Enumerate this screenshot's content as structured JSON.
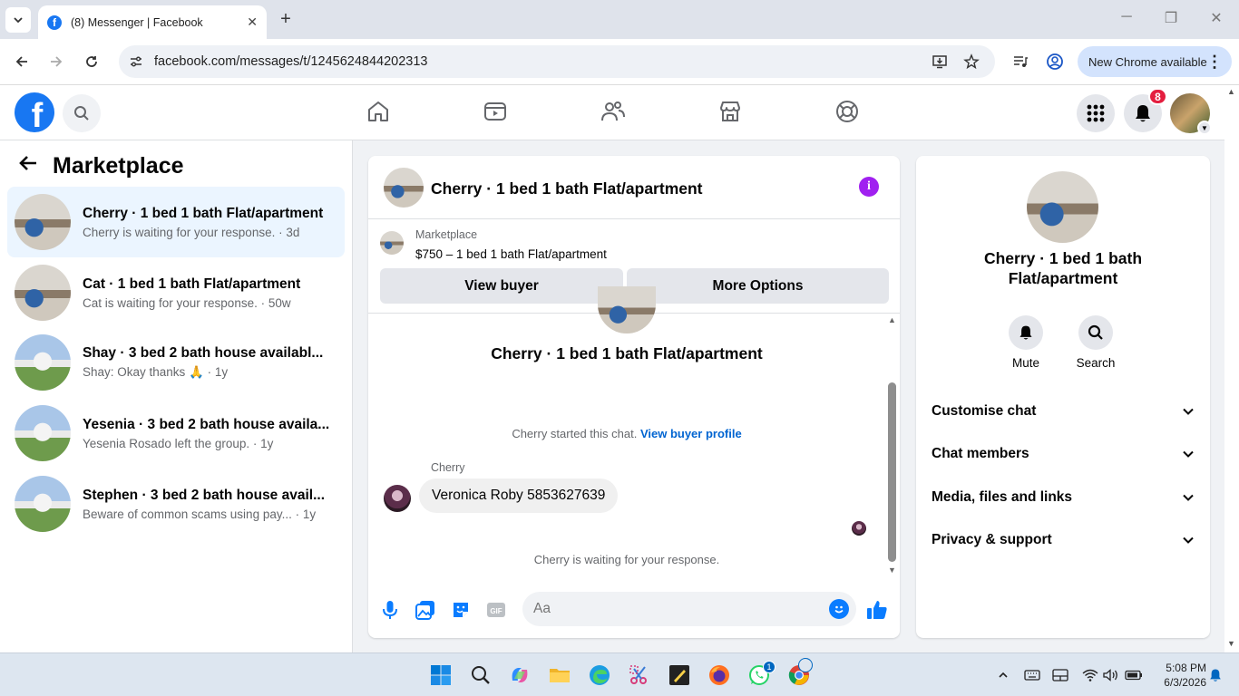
{
  "browser": {
    "tab_title": "(8) Messenger | Facebook",
    "url": "facebook.com/messages/t/1245624844202313",
    "new_chrome_label": "New Chrome available"
  },
  "fb_header": {
    "notification_count": "8"
  },
  "left_panel": {
    "title": "Marketplace",
    "conversations": [
      {
        "name": "Cherry · 1 bed 1 bath Flat/apartment",
        "preview": "Cherry is waiting for your response. · 3d",
        "thumb": "flat"
      },
      {
        "name": "Cat · 1 bed 1 bath Flat/apartment",
        "preview": "Cat is waiting for your response. · 50w",
        "thumb": "flat"
      },
      {
        "name": "Shay · 3 bed 2 bath house availabl...",
        "preview": "Shay: Okay thanks 🙏 · 1y",
        "thumb": "house"
      },
      {
        "name": "Yesenia · 3 bed 2 bath house availa...",
        "preview": "Yesenia Rosado left the group. · 1y",
        "thumb": "house"
      },
      {
        "name": "Stephen · 3 bed 2 bath house avail...",
        "preview": "Beware of common scams using pay... · 1y",
        "thumb": "house"
      }
    ]
  },
  "chat": {
    "header_name": "Cherry · 1 bed 1 bath Flat/apartment",
    "marketplace_label": "Marketplace",
    "listing": "$750 – 1 bed 1 bath Flat/apartment",
    "view_buyer_label": "View buyer",
    "more_options_label": "More Options",
    "body_name": "Cherry · 1 bed 1 bath Flat/apartment",
    "started_text": "Cherry started this chat.",
    "view_buyer_profile_link": "View buyer profile",
    "sender": "Cherry",
    "message": "Veronica Roby 5853627639",
    "waiting_text": "Cherry is waiting for your response.",
    "composer_placeholder": "Aa"
  },
  "right_panel": {
    "name": "Cherry · 1 bed 1 bath Flat/apartment",
    "mute_label": "Mute",
    "search_label": "Search",
    "sections": [
      "Customise chat",
      "Chat members",
      "Media, files and links",
      "Privacy & support"
    ]
  },
  "taskbar": {
    "time": "5:08 PM",
    "date": "6/3/2026",
    "whatsapp_badge": "1"
  },
  "colors": {
    "fb_blue": "#1877f2",
    "messenger_blue": "#0a7cff",
    "active_row": "#ebf5ff",
    "info_purple": "#a020f0"
  }
}
